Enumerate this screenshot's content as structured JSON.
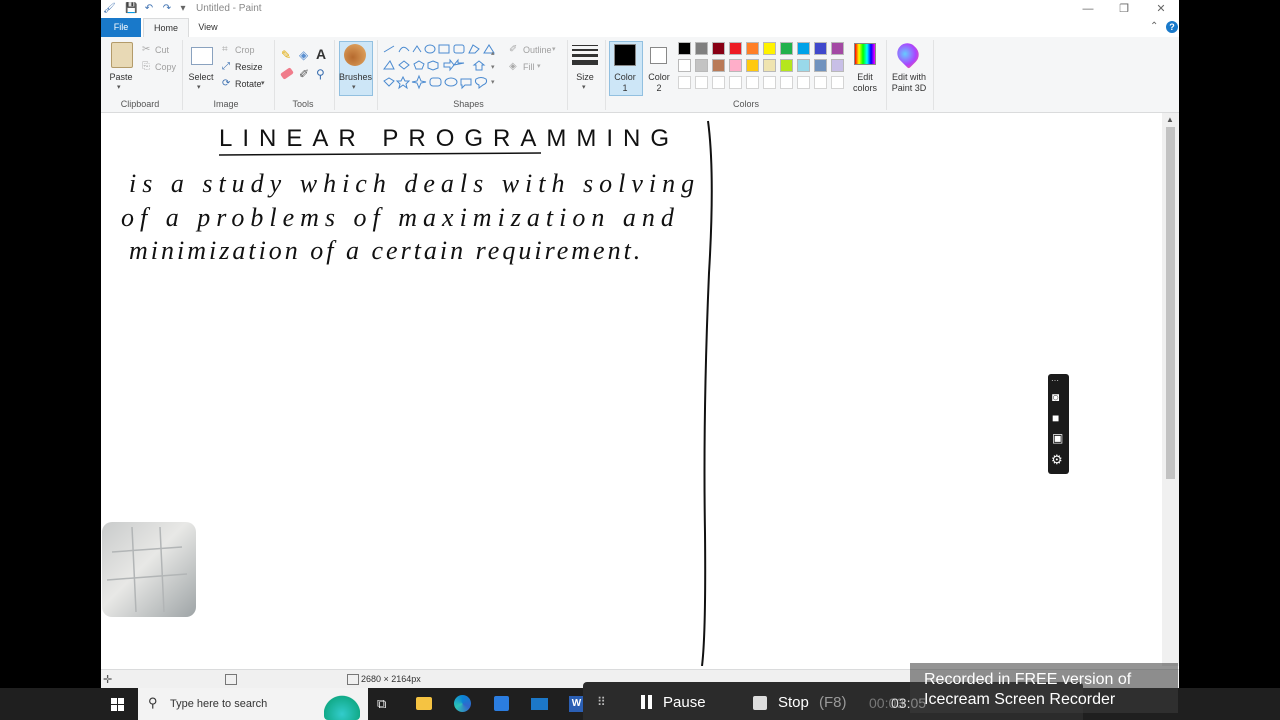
{
  "window": {
    "title": "Untitled - Paint",
    "controls": {
      "minimize": "—",
      "maximize": "❐",
      "close": "✕"
    }
  },
  "tabs": {
    "file": "File",
    "home": "Home",
    "view": "View",
    "help": "?"
  },
  "ribbon": {
    "clipboard": {
      "paste": "Paste",
      "cut": "Cut",
      "copy": "Copy",
      "group": "Clipboard"
    },
    "image": {
      "select": "Select",
      "crop": "Crop",
      "resize": "Resize",
      "rotate": "Rotate",
      "group": "Image"
    },
    "tools": {
      "group": "Tools"
    },
    "brushes": {
      "label": "Brushes"
    },
    "shapes": {
      "outline": "Outline",
      "fill": "Fill",
      "group": "Shapes"
    },
    "size": {
      "label": "Size"
    },
    "color1": {
      "label": "Color",
      "num": "1"
    },
    "color2": {
      "label": "Color",
      "num": "2"
    },
    "colors": {
      "group": "Colors",
      "row1": [
        "#000000",
        "#7f7f7f",
        "#880015",
        "#ed1c24",
        "#ff7f27",
        "#fff200",
        "#22b14c",
        "#00a2e8",
        "#3f48cc",
        "#a349a4"
      ],
      "row2": [
        "#ffffff",
        "#c3c3c3",
        "#b97a57",
        "#ffaec9",
        "#ffc90e",
        "#efe4b0",
        "#b5e61d",
        "#99d9ea",
        "#7092be",
        "#c8bfe7"
      ]
    },
    "edit_colors": {
      "line1": "Edit",
      "line2": "colors"
    },
    "paint3d": {
      "line1": "Edit with",
      "line2": "Paint 3D"
    }
  },
  "canvas": {
    "heading": "LINEAR PROGRAMMING",
    "lines": [
      "is a study which deals with solving",
      "of a problems of maximization and",
      "minimization of a certain requirement."
    ]
  },
  "status": {
    "dimensions": "2680 × 2164px"
  },
  "taskbar": {
    "search_placeholder": "Type here to search"
  },
  "recorder": {
    "pause": "Pause",
    "stop": "Stop",
    "stop_key": "(F8)",
    "timer_a": "00:03",
    "timer_b": "03:05"
  },
  "watermark": {
    "line1": "Recorded in FREE version of",
    "line2": "Icecream Screen Recorder"
  }
}
